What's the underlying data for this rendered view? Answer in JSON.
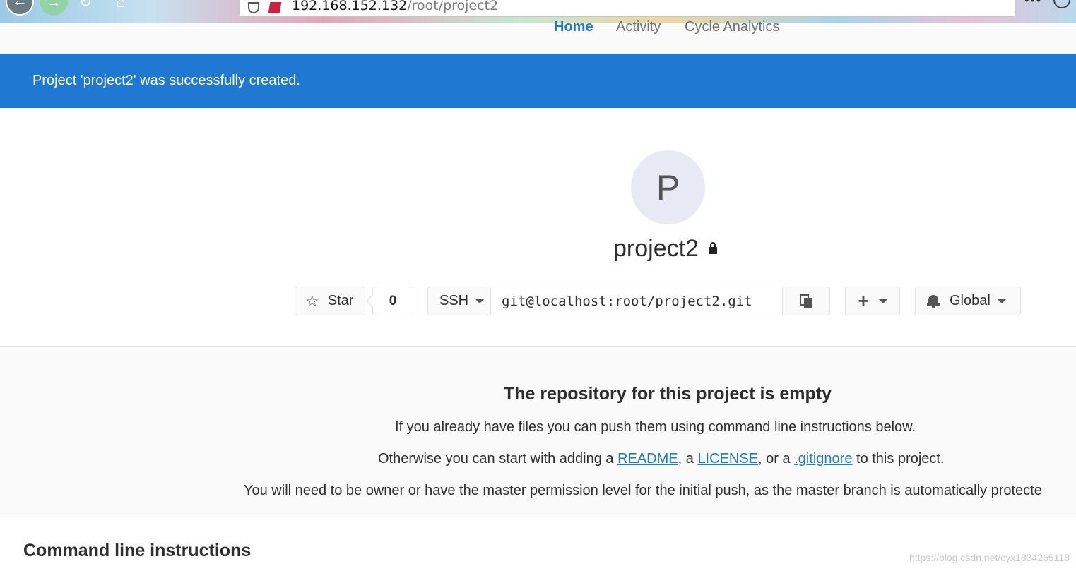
{
  "browser": {
    "url_host": "192.168.152.132",
    "url_path": "/root/project2"
  },
  "nav_tabs": [
    {
      "label": "Home",
      "active": true
    },
    {
      "label": "Activity",
      "active": false
    },
    {
      "label": "Cycle Analytics",
      "active": false
    }
  ],
  "flash": {
    "message": "Project 'project2' was successfully created."
  },
  "project": {
    "avatar_letter": "P",
    "name": "project2",
    "visibility_icon": "lock-icon"
  },
  "actions": {
    "star_label": "Star",
    "star_count": "0",
    "clone_protocol": "SSH",
    "clone_url": "git@localhost:root/project2.git",
    "notification_level": "Global"
  },
  "empty_repo": {
    "title": "The repository for this project is empty",
    "line1": "If you already have files you can push them using command line instructions below.",
    "line2_prefix": "Otherwise you can start with adding a ",
    "readme": "README",
    "sep1": ", a ",
    "license": "LICENSE",
    "sep2": ", or a ",
    "gitignore": ".gitignore",
    "line2_suffix": " to this project.",
    "line3": "You will need to be owner or have the master permission level for the initial push, as the master branch is automatically protecte"
  },
  "cli": {
    "title": "Command line instructions"
  },
  "watermark": "https://blog.csdn.net/cyx1834265118",
  "colors": {
    "accent": "#1f78d1",
    "section_bg": "#fafafa"
  }
}
